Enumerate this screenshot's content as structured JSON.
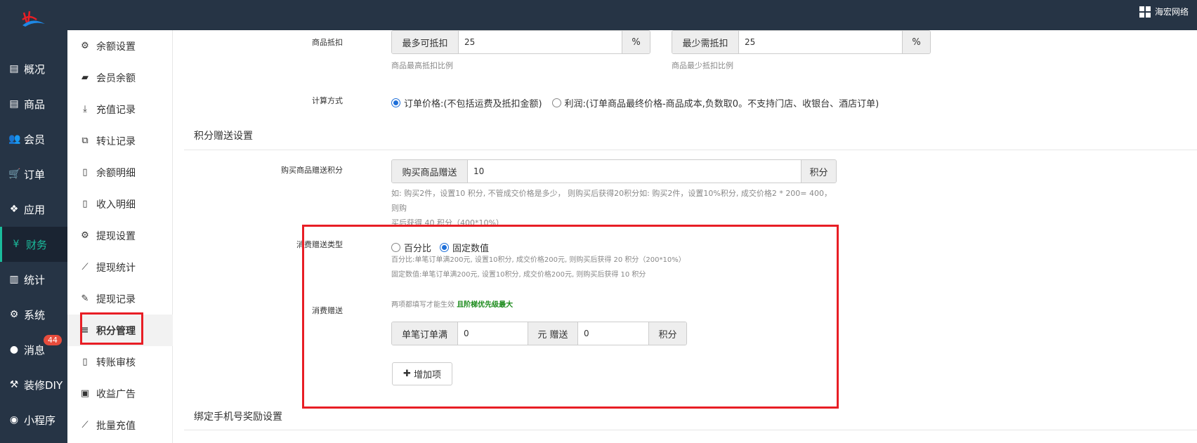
{
  "topbar": {
    "brand": "海宏网络"
  },
  "sidebar": {
    "items": [
      {
        "label": "概况",
        "icon": "archive-icon"
      },
      {
        "label": "商品",
        "icon": "archive-icon"
      },
      {
        "label": "会员",
        "icon": "users-icon"
      },
      {
        "label": "订单",
        "icon": "cart-icon"
      },
      {
        "label": "应用",
        "icon": "cubes-icon"
      },
      {
        "label": "财务",
        "icon": "yen-icon",
        "active": true
      },
      {
        "label": "统计",
        "icon": "bar-chart-icon"
      },
      {
        "label": "系统",
        "icon": "cogs-icon"
      },
      {
        "label": "消息",
        "icon": "comment-icon",
        "badge": "44"
      },
      {
        "label": "装修DIY",
        "icon": "gavel-icon"
      },
      {
        "label": "小程序",
        "icon": "wechat-icon"
      }
    ]
  },
  "submenu": {
    "items": [
      {
        "label": "余额设置"
      },
      {
        "label": "会员余额"
      },
      {
        "label": "充值记录"
      },
      {
        "label": "转让记录"
      },
      {
        "label": "余额明细"
      },
      {
        "label": "收入明细"
      },
      {
        "label": "提现设置"
      },
      {
        "label": "提现统计"
      },
      {
        "label": "提现记录"
      },
      {
        "label": "积分管理",
        "active": true
      },
      {
        "label": "转账审核"
      },
      {
        "label": "收益广告"
      },
      {
        "label": "批量充值"
      }
    ]
  },
  "deduct": {
    "label": "商品抵扣",
    "max_addon": "最多可抵扣",
    "max_value": "25",
    "pct": "%",
    "max_help": "商品最高抵扣比例",
    "min_addon": "最少需抵扣",
    "min_value": "25",
    "min_help": "商品最少抵扣比例"
  },
  "calc": {
    "label": "计算方式",
    "opt1": "订单价格:(不包括运费及抵扣金额)",
    "opt2": "利润:(订单商品最终价格-商品成本,负数取0。不支持门店、收银台、酒店订单)"
  },
  "gift_section": {
    "title": "积分赠送设置"
  },
  "buy_gift": {
    "label": "购买商品赠送积分",
    "addon": "购买商品赠送",
    "value": "10",
    "unit": "积分",
    "help1": "如: 购买2件，设置10 积分, 不管成交价格是多少， 则购买后获得20积分如: 购买2件，设置10%积分, 成交价格2 * 200= 400， 则购",
    "help2": "买后获得 40 积分（400*10%）"
  },
  "consume_type": {
    "label": "消费赠送类型",
    "opt1": "百分比",
    "opt2": "固定数值",
    "help1": "百分比:单笔订单满200元, 设置10积分, 成交价格200元, 则购买后获得 20 积分（200*10%）",
    "help2": "固定数值:单笔订单满200元, 设置10积分, 成交价格200元, 则购买后获得 10 积分"
  },
  "consume_gift": {
    "label": "消费赠送",
    "note": "两项都填写才能生效",
    "note_strong": "且阶梯优先级最大",
    "addon1": "单笔订单满",
    "value1": "0",
    "addon2": "元 赠送",
    "value2": "0",
    "unit": "积分",
    "add_button": "增加项"
  },
  "bind_section": {
    "title": "绑定手机号奖励设置"
  }
}
